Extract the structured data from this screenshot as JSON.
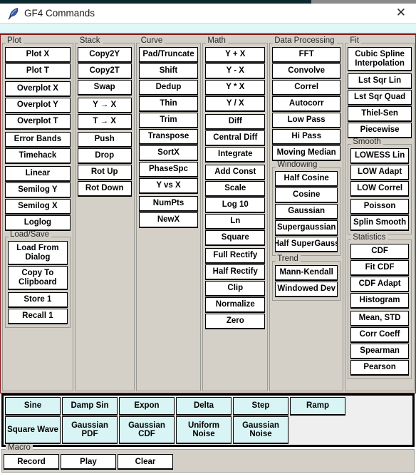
{
  "window": {
    "title": "GF4 Commands",
    "icon": "feather-icon",
    "close_label": "✕"
  },
  "colors": {
    "panel_bg": "#d4d0c8",
    "panel_border": "#8b1a1a",
    "button_bg": "#ffffff",
    "generator_button_bg": "#d8f4f4",
    "title_strip": "#e0f7f7"
  },
  "columns": [
    {
      "legend": "Plot",
      "blocks": [
        {
          "buttons": [
            "Plot X",
            "Plot T"
          ]
        },
        {
          "buttons": [
            "Overplot X",
            "Overplot Y",
            "Overplot T"
          ]
        },
        {
          "buttons": [
            "Error Bands",
            "Timehack"
          ]
        },
        {
          "buttons": [
            "Linear",
            "Semilog Y",
            "Semilog X",
            "Loglog"
          ]
        }
      ],
      "subgroup": {
        "legend": "Load/Save",
        "blocks": [
          {
            "buttons": [
              "Load From Dialog",
              "Copy To Clipboard"
            ],
            "two_line": true
          },
          {
            "buttons": [
              "Store 1",
              "Recall 1"
            ]
          }
        ]
      }
    },
    {
      "legend": "Stack",
      "blocks": [
        {
          "buttons": [
            "Copy2Y",
            "Copy2T",
            "Swap"
          ]
        },
        {
          "buttons": [
            "Y → X",
            "T → X"
          ]
        },
        {
          "buttons": [
            "Push",
            "Drop",
            "Rot Up",
            "Rot Down"
          ]
        }
      ]
    },
    {
      "legend": "Curve",
      "blocks": [
        {
          "buttons": [
            "Pad/Truncate",
            "Shift",
            "Dedup",
            "Thin",
            "Trim",
            "Transpose",
            "SortX",
            "PhaseSpc",
            "Y vs X"
          ]
        },
        {
          "buttons": [
            "NumPts",
            "NewX"
          ]
        }
      ]
    },
    {
      "legend": "Math",
      "blocks": [
        {
          "buttons": [
            "Y + X",
            "Y - X",
            "Y * X",
            "Y / X"
          ]
        },
        {
          "buttons": [
            "Diff",
            "Central Diff",
            "Integrate"
          ]
        },
        {
          "buttons": [
            "Add Const",
            "Scale",
            "Log 10",
            "Ln",
            "Square"
          ]
        },
        {
          "buttons": [
            "Full Rectify",
            "Half Rectify",
            "Clip",
            "Normalize",
            "Zero"
          ]
        }
      ]
    },
    {
      "legend": "Data Processing",
      "blocks": [
        {
          "buttons": [
            "FFT",
            "Convolve",
            "Correl",
            "Autocorr",
            "Low Pass",
            "Hi Pass",
            "Moving Median"
          ]
        }
      ],
      "subgroups": [
        {
          "legend": "Windowing",
          "blocks": [
            {
              "buttons": [
                "Half Cosine",
                "Cosine",
                "Gaussian",
                "Supergaussian",
                "Half SuperGauss"
              ]
            }
          ]
        },
        {
          "legend": "Trend",
          "blocks": [
            {
              "buttons": [
                "Mann-Kendall",
                "Windowed Dev"
              ]
            }
          ]
        }
      ]
    },
    {
      "legend": "Fit",
      "blocks": [
        {
          "buttons": [
            "Cubic Spline Interpolation"
          ],
          "two_line": true
        },
        {
          "buttons": [
            "Lst Sqr Lin",
            "Lst Sqr Quad",
            "Thiel-Sen",
            "Piecewise"
          ]
        }
      ],
      "subgroups": [
        {
          "legend": "Smooth",
          "blocks": [
            {
              "buttons": [
                "LOWESS Lin",
                "LOW Adapt",
                "LOW Correl"
              ]
            },
            {
              "buttons": [
                "Poisson",
                "Splin Smooth"
              ]
            }
          ]
        },
        {
          "legend": "Statistics",
          "blocks": [
            {
              "buttons": [
                "CDF",
                "Fit CDF",
                "CDF Adapt",
                "Histogram"
              ]
            },
            {
              "buttons": [
                "Mean, STD",
                "Corr Coeff",
                "Spearman",
                "Pearson"
              ]
            }
          ]
        }
      ]
    }
  ],
  "generators": {
    "row1": [
      "Sine",
      "Damp Sin",
      "Expon",
      "Delta",
      "Step",
      "Ramp"
    ],
    "row2": [
      "Square Wave",
      "Gaussian PDF",
      "Gaussian CDF",
      "Uniform Noise",
      "Gaussian Noise"
    ]
  },
  "macro": {
    "legend": "Macro",
    "buttons": [
      "Record",
      "Play",
      "Clear"
    ]
  }
}
